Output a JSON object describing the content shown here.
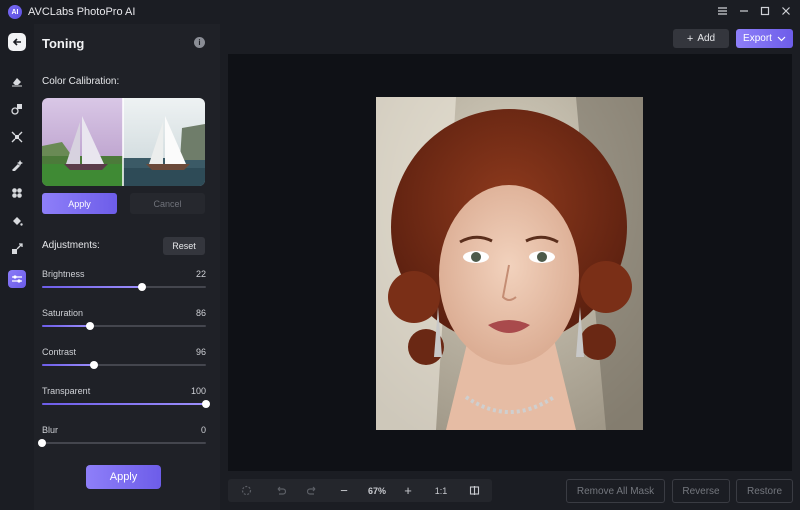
{
  "app": {
    "title": "AVCLabs PhotoPro AI",
    "logo_text": "AI"
  },
  "window": {
    "menu_icon": "hamburger-icon",
    "minimize_icon": "minimize-icon",
    "maximize_icon": "maximize-icon",
    "close_icon": "close-icon"
  },
  "rail": {
    "items": [
      {
        "name": "back-icon"
      },
      {
        "name": "eraser-icon"
      },
      {
        "name": "shapes-icon"
      },
      {
        "name": "enhance-icon"
      },
      {
        "name": "magic-brush-icon"
      },
      {
        "name": "grid-icon"
      },
      {
        "name": "paint-bucket-icon"
      },
      {
        "name": "resize-icon"
      },
      {
        "name": "toning-icon",
        "active": true
      }
    ]
  },
  "panel": {
    "title": "Toning",
    "color_calibration_label": "Color Calibration:",
    "apply_label": "Apply",
    "cancel_label": "Cancel",
    "adjustments_label": "Adjustments:",
    "reset_label": "Reset",
    "sliders": [
      {
        "name": "Brightness",
        "value": "22",
        "position": 0.61
      },
      {
        "name": "Saturation",
        "value": "86",
        "position": 0.29
      },
      {
        "name": "Contrast",
        "value": "96",
        "position": 0.32
      },
      {
        "name": "Transparent",
        "value": "100",
        "position": 1.0
      },
      {
        "name": "Blur",
        "value": "0",
        "position": 0.0
      }
    ],
    "bottom_apply_label": "Apply"
  },
  "topbar": {
    "add_label": "Add",
    "add_icon": "+",
    "export_label": "Export"
  },
  "bottombar": {
    "zoom": "67%",
    "ratio": "1:1",
    "zoom_out": "−",
    "zoom_in": "+",
    "remove_all_mask_label": "Remove All Mask",
    "reverse_label": "Reverse",
    "restore_label": "Restore"
  },
  "colors": {
    "accent": "#7b6cf6",
    "background": "#1b1d23",
    "panel": "#1f2127",
    "canvas": "#0f1116"
  }
}
